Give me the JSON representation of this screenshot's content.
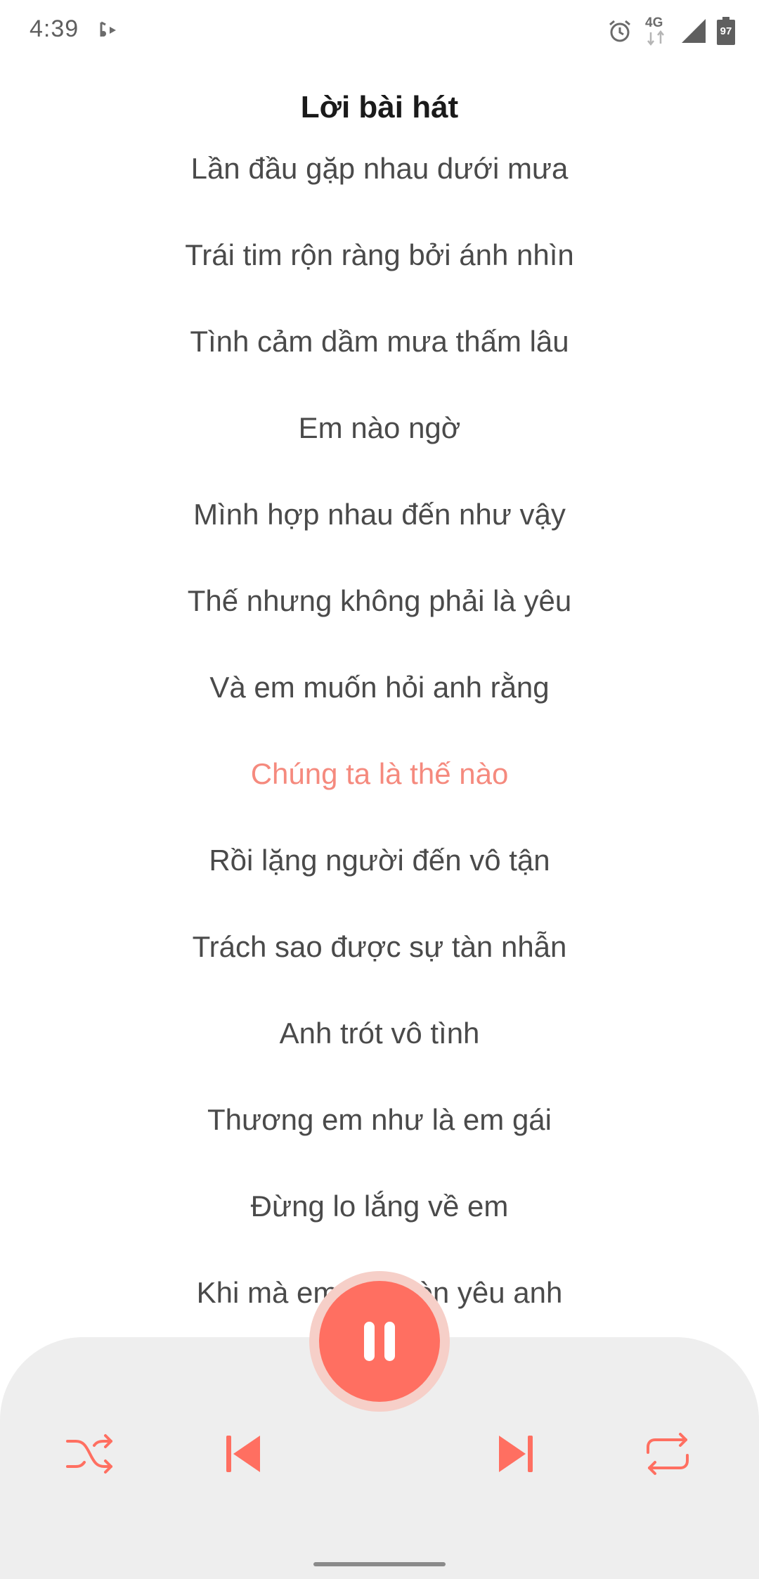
{
  "status_bar": {
    "time": "4:39",
    "network": "4G",
    "battery": "97",
    "icons": [
      "media-playing-icon",
      "alarm-icon",
      "network-4g-icon",
      "signal-icon",
      "battery-icon"
    ]
  },
  "title": "Lời bài hát",
  "lyrics": [
    "Lần đầu gặp nhau dưới mưa",
    "Trái tim rộn ràng bởi ánh nhìn",
    "Tình cảm dầm mưa thấm lâu",
    "Em nào ngờ",
    "Mình hợp nhau đến như vậy",
    "Thế nhưng không phải là yêu",
    "Và em muốn hỏi anh rằng",
    "Chúng ta là thế nào",
    "Rồi lặng người đến vô tận",
    "Trách sao được sự tàn nhẫn",
    "Anh trót vô tình",
    "Thương em như là em gái",
    "Đừng lo lắng về em",
    "Khi mà em vẫn còn yêu anh"
  ],
  "active_line_index": 7,
  "player": {
    "state": "playing",
    "controls": [
      "shuffle-icon",
      "previous-icon",
      "pause-icon",
      "next-icon",
      "repeat-icon"
    ]
  },
  "colors": {
    "accent": "#ff6f61",
    "accent_halo": "#f6cfc8",
    "active_lyric": "#f58a7e",
    "lyric_text": "#4a4a4a",
    "title_text": "#1a1a1a",
    "panel_bg": "#eeeeee"
  }
}
